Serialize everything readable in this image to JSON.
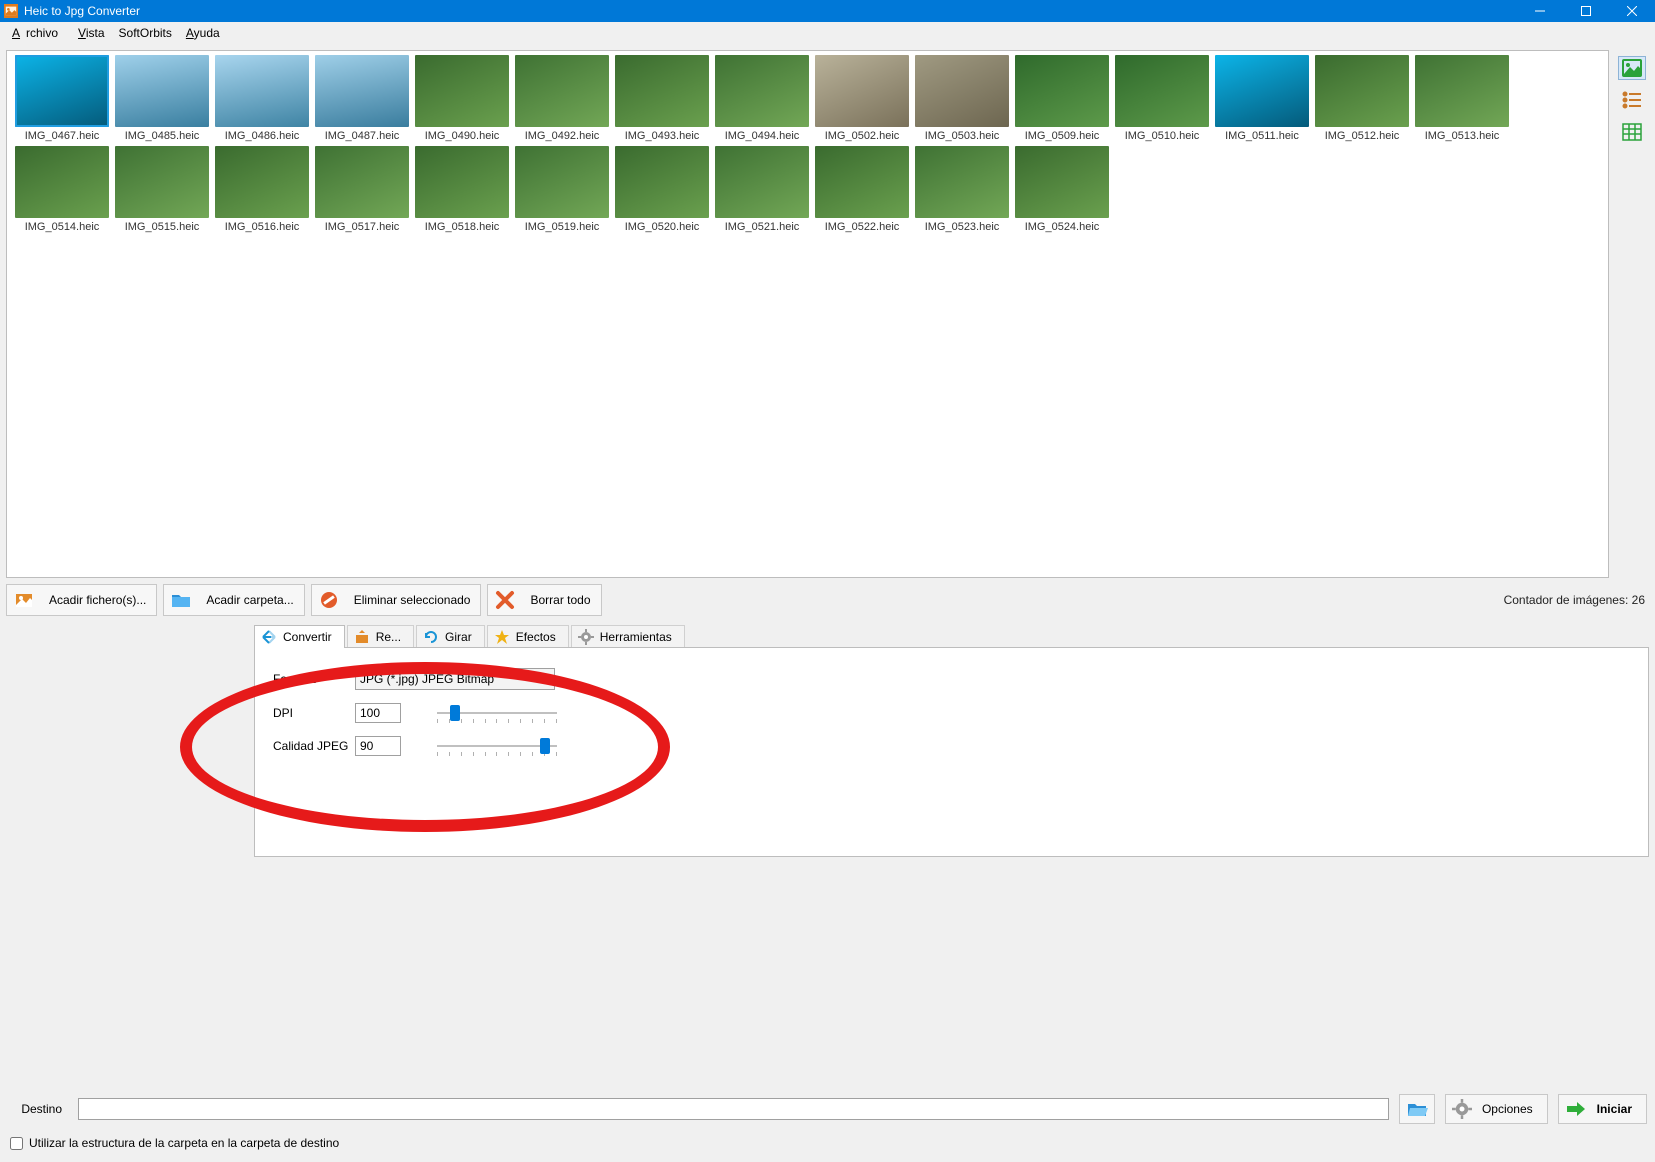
{
  "window": {
    "title": "Heic to Jpg Converter"
  },
  "menu": {
    "items": [
      "Archivo",
      "Vista",
      "SoftOrbits",
      "Ayuda"
    ]
  },
  "thumbnails": [
    {
      "name": "IMG_0467.heic",
      "selected": true,
      "c": 0
    },
    {
      "name": "IMG_0485.heic",
      "c": 1
    },
    {
      "name": "IMG_0486.heic",
      "c": 2
    },
    {
      "name": "IMG_0487.heic",
      "c": 3
    },
    {
      "name": "IMG_0490.heic",
      "c": 4
    },
    {
      "name": "IMG_0492.heic",
      "c": 5
    },
    {
      "name": "IMG_0493.heic",
      "c": 6
    },
    {
      "name": "IMG_0494.heic",
      "c": 7
    },
    {
      "name": "IMG_0502.heic",
      "c": 8
    },
    {
      "name": "IMG_0503.heic",
      "c": 9
    },
    {
      "name": "IMG_0509.heic",
      "c": 10
    },
    {
      "name": "IMG_0510.heic",
      "c": 11
    },
    {
      "name": "IMG_0511.heic",
      "c": 0
    },
    {
      "name": "IMG_0512.heic",
      "c": 4
    },
    {
      "name": "IMG_0513.heic",
      "c": 5
    },
    {
      "name": "IMG_0514.heic",
      "c": 6
    },
    {
      "name": "IMG_0515.heic",
      "c": 7
    },
    {
      "name": "IMG_0516.heic",
      "c": 4
    },
    {
      "name": "IMG_0517.heic",
      "c": 5
    },
    {
      "name": "IMG_0518.heic",
      "c": 6
    },
    {
      "name": "IMG_0519.heic",
      "c": 7
    },
    {
      "name": "IMG_0520.heic",
      "c": 4
    },
    {
      "name": "IMG_0521.heic",
      "c": 5
    },
    {
      "name": "IMG_0522.heic",
      "c": 6
    },
    {
      "name": "IMG_0523.heic",
      "c": 7
    },
    {
      "name": "IMG_0524.heic",
      "c": 4
    }
  ],
  "toolbar": {
    "add_files": "Acadir fichero(s)...",
    "add_folder": "Acadir carpeta...",
    "delete_selected": "Eliminar seleccionado",
    "clear_all": "Borrar todo"
  },
  "counter_label": "Contador de imágenes: 26",
  "tabs": {
    "convert": "Convertir",
    "resize": "Re...",
    "rotate": "Girar",
    "effects": "Efectos",
    "tools": "Herramientas"
  },
  "convert": {
    "format_label": "Formato",
    "format_value": "JPG (*.jpg) JPEG Bitmap",
    "dpi_label": "DPI",
    "dpi_value": "100",
    "quality_label": "Calidad JPEG",
    "quality_value": "90"
  },
  "bottom": {
    "dest_label": "Destino",
    "dest_value": "",
    "options": "Opciones",
    "start": "Iniciar",
    "use_folder_structure": "Utilizar la estructura de la carpeta en la carpeta de destino"
  }
}
